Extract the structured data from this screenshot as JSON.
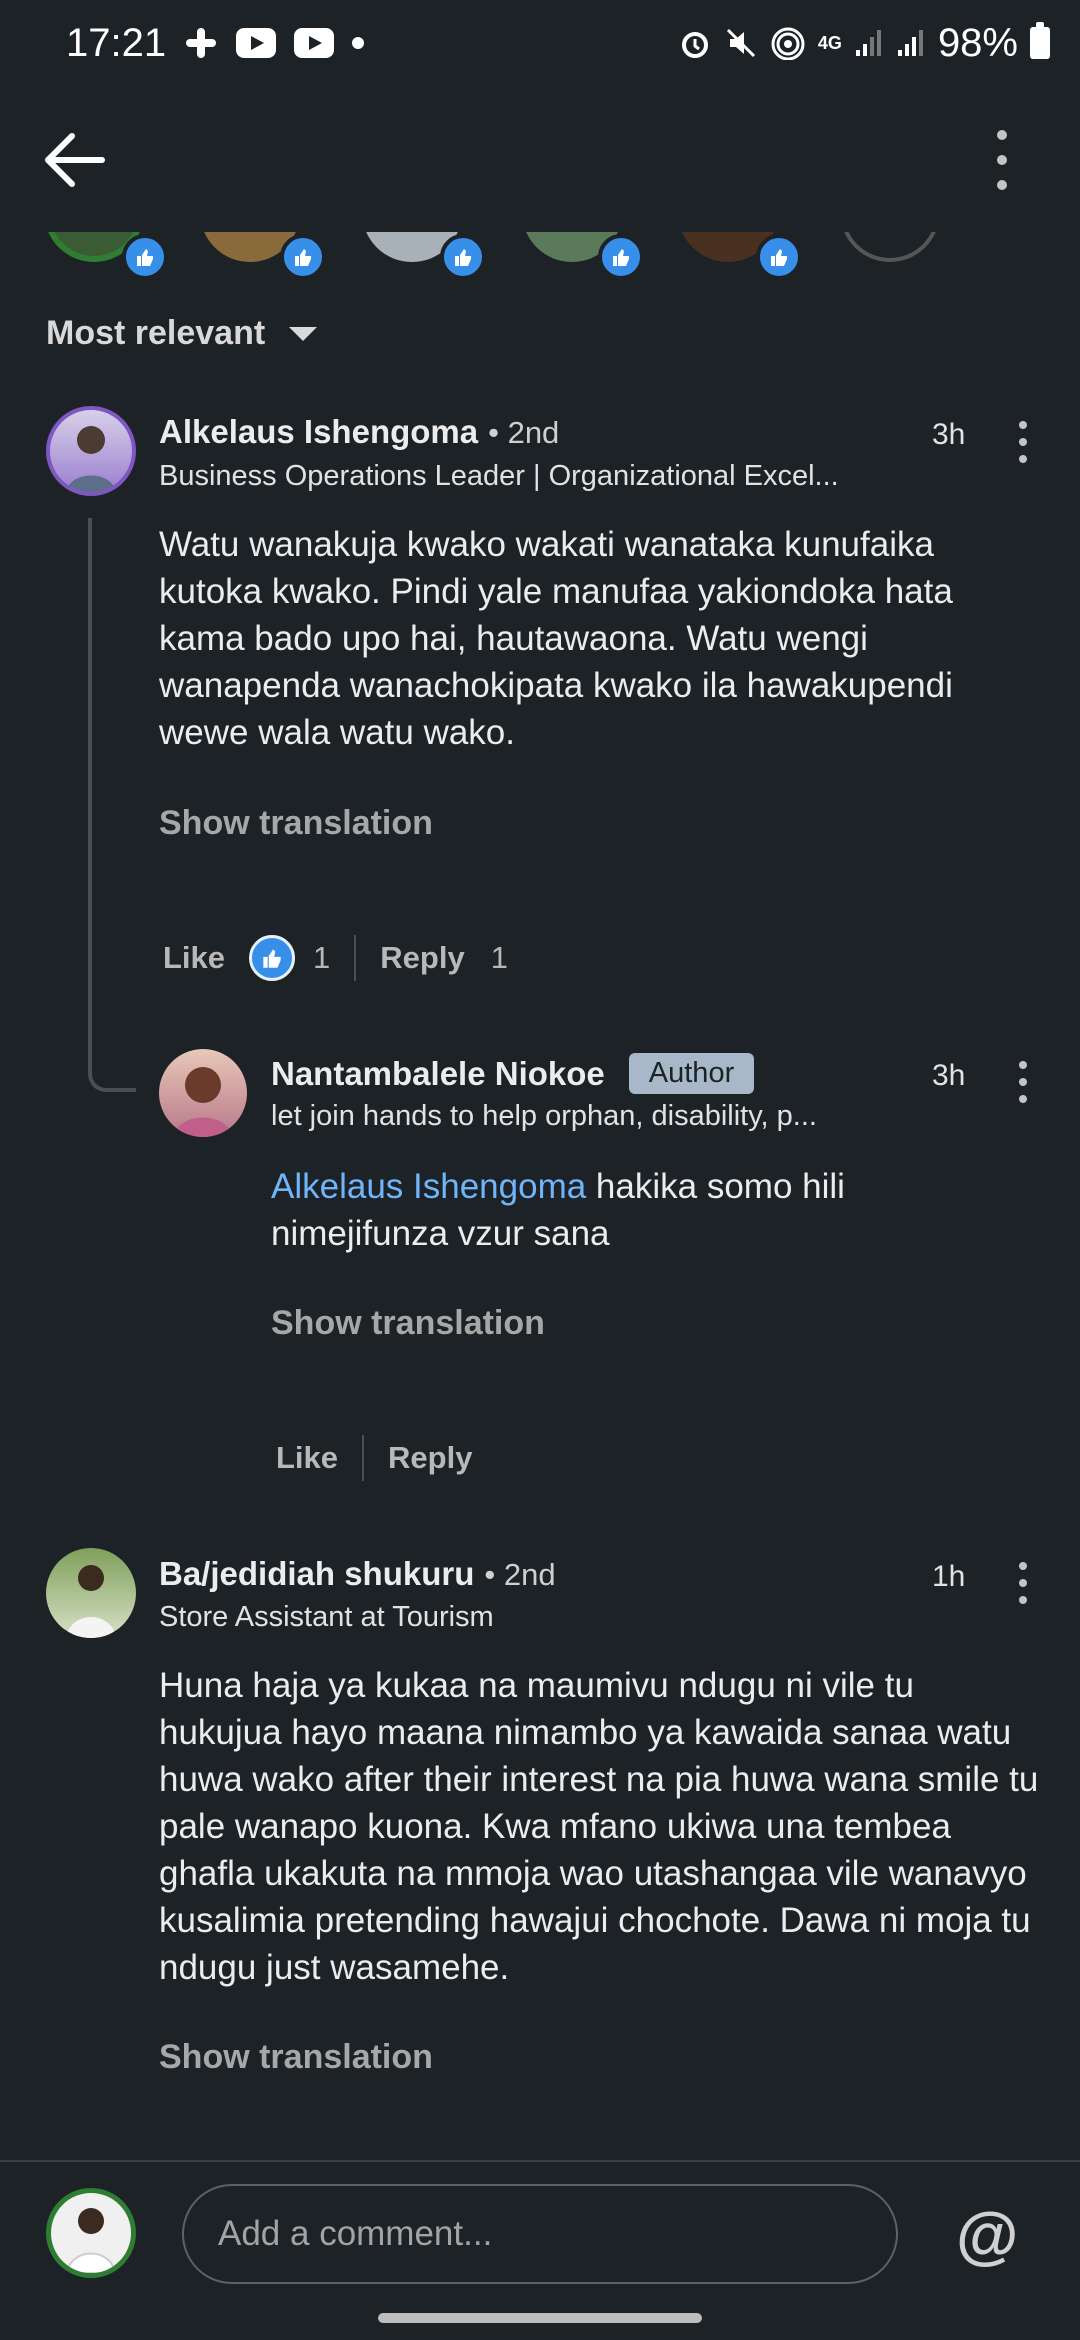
{
  "status_bar": {
    "time": "17:21",
    "battery": "98%",
    "network": "4G"
  },
  "sort": {
    "label": "Most relevant"
  },
  "comments": [
    {
      "name": "Alkelaus Ishengoma",
      "degree": "• 2nd",
      "headline": "Business Operations Leader | Organizational Excel...",
      "time": "3h",
      "text": "Watu wanakuja kwako wakati wanataka kunufaika kutoka kwako. Pindi yale manufaa yakiondoka hata kama bado upo hai, hautawaona. Watu wengi wanapenda wanachokipata kwako ila hawakupendi wewe wala watu wako.",
      "show_translation": "Show translation",
      "like_label": "Like",
      "like_count": "1",
      "reply_label": "Reply",
      "reply_count": "1"
    },
    {
      "name": "Nantambalele Niokoe",
      "author_tag": "Author",
      "headline": "let join hands to help orphan, disability, p...",
      "time": "3h",
      "mention": "Alkelaus Ishengoma",
      "text": " hakika somo hili nimejifunza vzur sana",
      "show_translation": "Show translation",
      "like_label": "Like",
      "reply_label": "Reply"
    },
    {
      "name": "Ba/jedidiah shukuru",
      "degree": "• 2nd",
      "headline": "Store Assistant at Tourism",
      "time": "1h",
      "text": "Huna haja ya kukaa na maumivu ndugu ni vile tu hukujua hayo maana nimambo ya kawaida sanaa watu huwa wako after their interest  na pia huwa wana smile tu pale wanapo kuona. Kwa mfano ukiwa una tembea ghafla ukakuta na mmoja wao utashangaa vile wanavyo kusalimia pretending hawajui chochote.  Dawa ni moja tu ndugu just wasamehe.",
      "show_translation": "Show translation"
    }
  ],
  "composer": {
    "placeholder": "Add a comment...",
    "at_symbol": "@"
  },
  "colors": {
    "background": "#1d2226",
    "accent": "#378fe9",
    "mention": "#70b5f9"
  }
}
